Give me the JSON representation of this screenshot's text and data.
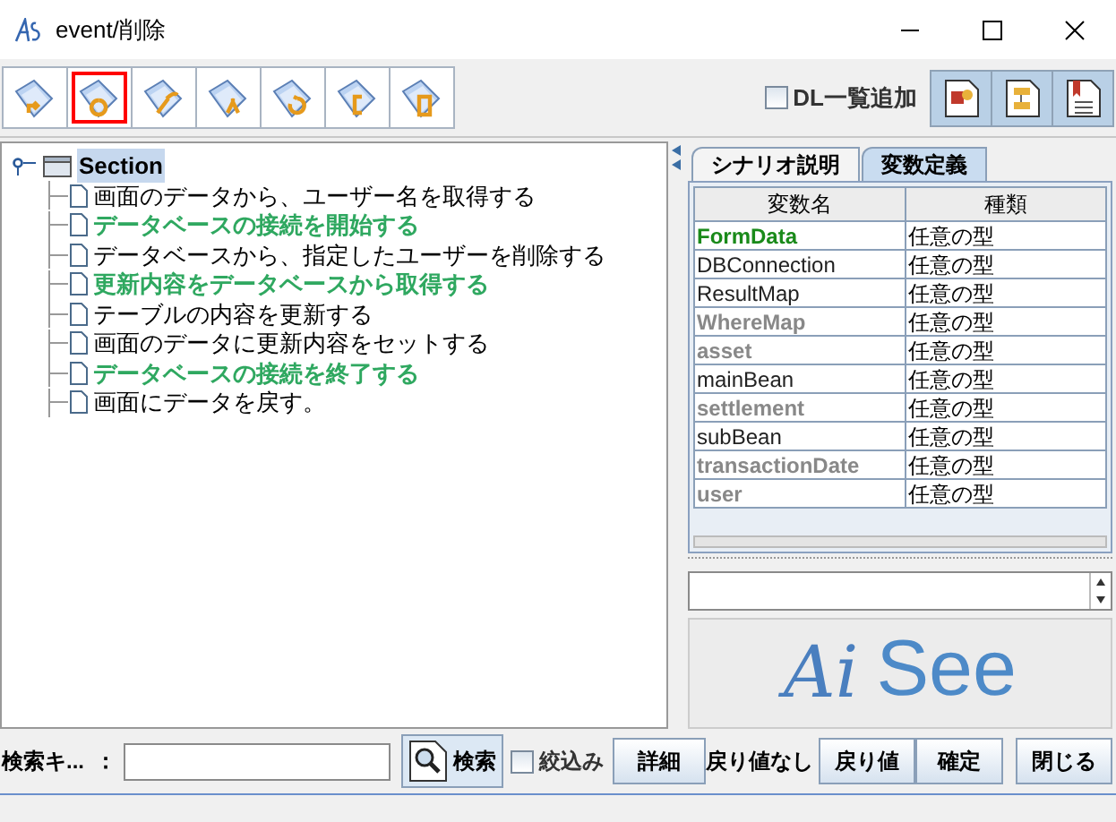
{
  "window": {
    "title": "event/削除"
  },
  "toolbar": {
    "buttons": [
      {
        "selected": false
      },
      {
        "selected": true
      },
      {
        "selected": false
      },
      {
        "selected": false
      },
      {
        "selected": false
      },
      {
        "selected": false
      },
      {
        "selected": false
      }
    ],
    "dl_checkbox": {
      "label": "DL一覧追加",
      "checked": false
    }
  },
  "tree": {
    "label": "Section",
    "selected": true,
    "expanded": true,
    "children": [
      {
        "label": "画面のデータから、ユーザー名を取得する",
        "highlighted": false
      },
      {
        "label": "データベースの接続を開始する",
        "highlighted": true
      },
      {
        "label": "データベースから、指定したユーザーを削除する",
        "highlighted": false
      },
      {
        "label": "更新内容をデータベースから取得する",
        "highlighted": true
      },
      {
        "label": "テーブルの内容を更新する",
        "highlighted": false
      },
      {
        "label": "画面のデータに更新内容をセットする",
        "highlighted": false
      },
      {
        "label": "データベースの接続を終了する",
        "highlighted": true
      },
      {
        "label": "画面にデータを戻す。",
        "highlighted": false
      }
    ]
  },
  "tabs": [
    {
      "label": "シナリオ説明",
      "selected": false
    },
    {
      "label": "変数定義",
      "selected": true
    }
  ],
  "table": {
    "columns": [
      "変数名",
      "種類"
    ],
    "rows": [
      {
        "kind": "green",
        "cells": [
          "FormData",
          "任意の型"
        ]
      },
      {
        "kind": "normal",
        "cells": [
          "DBConnection",
          "任意の型"
        ]
      },
      {
        "kind": "normal",
        "cells": [
          "ResultMap",
          "任意の型"
        ]
      },
      {
        "kind": "gray",
        "cells": [
          "WhereMap",
          "任意の型"
        ]
      },
      {
        "kind": "gray",
        "cells": [
          "asset",
          "任意の型"
        ]
      },
      {
        "kind": "normal",
        "cells": [
          "mainBean",
          "任意の型"
        ]
      },
      {
        "kind": "gray",
        "cells": [
          "settlement",
          "任意の型"
        ]
      },
      {
        "kind": "normal",
        "cells": [
          "subBean",
          "任意の型"
        ]
      },
      {
        "kind": "gray",
        "cells": [
          "transactionDate",
          "任意の型"
        ]
      },
      {
        "kind": "gray",
        "cells": [
          "user",
          "任意の型"
        ]
      }
    ]
  },
  "logo": {
    "script": "Ai",
    "word": "See"
  },
  "bottom": {
    "search_label": "検索キ...",
    "colon": "：",
    "search_button": "検索",
    "filter_checkbox": {
      "label": "絞込み",
      "checked": false
    },
    "detail_button": "詳細",
    "return_status": "戻り値なし",
    "return_button": "戻り値",
    "confirm_button": "確定",
    "close_button": "閉じる"
  }
}
